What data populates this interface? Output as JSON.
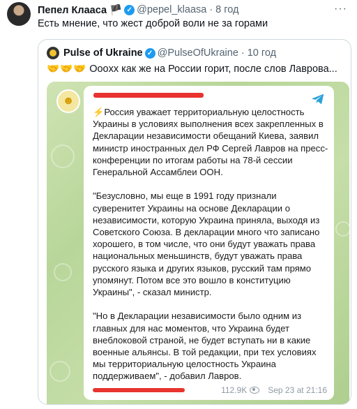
{
  "tweet": {
    "author_name": "Пепел Клааса 🏴",
    "author_handle": "@pepel_klaasa",
    "separator": "·",
    "time": "8 год",
    "more_icon": "more-horizontal-icon",
    "text": "Есть мнение, что жест доброй воли не за горами"
  },
  "quote": {
    "author_name": "Pulse of Ukraine",
    "author_handle": "@PulseOfUkraine",
    "separator": "·",
    "time": "10 год",
    "emoji": "🤝🤝🤝",
    "text": "Оооxx как же на России горит, после слов Лаврова..."
  },
  "media": {
    "paragraph1_emoji": "⚡",
    "paragraph1": "Россия уважает территориальную целостность Украины в условиях выполнения всех закрепленных в Декларации независимости обещаний Киева, заявил министр иностранных дел РФ Сергей Лавров на пресс-конференции по итогам работы на 78-й сессии Генеральной Ассамблеи ООН.",
    "paragraph2": "\"Безусловно, мы еще в 1991 году признали суверенитет Украины на основе Декларации о независимости, которую Украина приняла, выходя из Советского Союза. В декларации много что записано хорошего, в том числе, что они будут уважать права национальных меньшинств, будут уважать права русского языка и других языков, русский там прямо упомянут. Потом все это вошло в конституцию Украины\", - сказал министр.",
    "paragraph3": "\"Но в Декларации независимости было одним из главных для нас моментов, что Украина будет внеблоковой страной, не будет вступать ни в какие военные альянсы. В той редакции, при тех условиях мы территориальную целостность Украина поддерживаем\", - добавил Лавров.",
    "views": "112.9K",
    "date": "Sep 23 at 21:16"
  },
  "colors": {
    "verified": "#1d9bf0",
    "telegram": "#2aa1da",
    "redaction": "#e8332f",
    "muted": "#536471"
  }
}
